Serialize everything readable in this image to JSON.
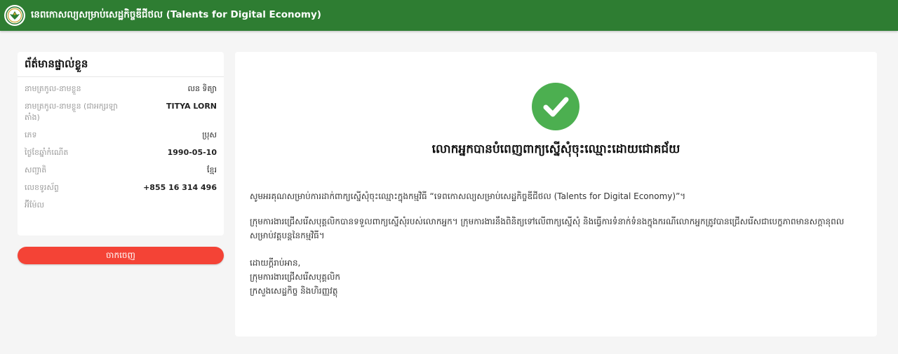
{
  "header": {
    "title": "នេពកោសល្យសម្រាប់សេដ្ឋកិច្ចឌីជីថល (Talents for Digital Economy)",
    "brand_color": "#2e7d32"
  },
  "profile": {
    "title": "ព័ត៌មានផ្ទាល់ខ្លួន",
    "rows": [
      {
        "label": "នាមត្រកូល-នាមខ្លួន",
        "value": "លន ទិត្យា"
      },
      {
        "label": "នាមត្រកូល-នាមខ្លួន (ជាអក្សរឡាតាំង)",
        "value": "TITYA LORN"
      },
      {
        "label": "ភេទ",
        "value": "ប្រុស"
      },
      {
        "label": "ថ្ងៃខែឆ្នាំកំណើត",
        "value": "1990-05-10"
      },
      {
        "label": "សញ្ជាតិ",
        "value": "ខ្មែរ"
      },
      {
        "label": "លេខទូរស័ព្ទ",
        "value": "+855 16 314 496"
      },
      {
        "label": "អ៊ីម៉ែល",
        "value": ""
      }
    ]
  },
  "logout": {
    "label": "ចាកចេញ",
    "color": "#f44336"
  },
  "success": {
    "icon": "check-circle-icon",
    "icon_color": "#4caf50",
    "title": "លោកអ្នកបានបំពេញពាក្យស្នើសុំចុះឈ្មោះដោយជោគជ័យ",
    "paragraph1": "សូមអរគុណសម្រាប់ការដាក់ពាក្យស្នើសុំចុះឈ្មោះក្នុងកម្មវិធី “ទេពកោសល្យសម្រាប់សេដ្ឋកិច្ចឌីជីថល (Talents for Digital Economy)”។",
    "paragraph2": "ក្រុមការងារជ្រើសរើសបុគ្គលិកបានទទួលពាក្យស្នើសុំរបស់លោកអ្នក។ ក្រុមការងារនឹងពិនិត្យទៅលើពាក្យស្នើសុំ និងធ្វើការទំនាក់ទំនងក្នុងករណីលោកអ្នកត្រូវបានជ្រើសរើសជាបេក្ខភាពមានសក្តានុពលសម្រាប់វគ្គបន្តនៃកម្មវិធី។",
    "closing": "ដោយក្តីរាប់អាន,",
    "signature1": "ក្រុមការងារជ្រើសរើសបុគ្គលិក",
    "signature2": "ក្រសួងសេដ្ឋកិច្ច និងហិរញ្ញវត្ថុ"
  }
}
